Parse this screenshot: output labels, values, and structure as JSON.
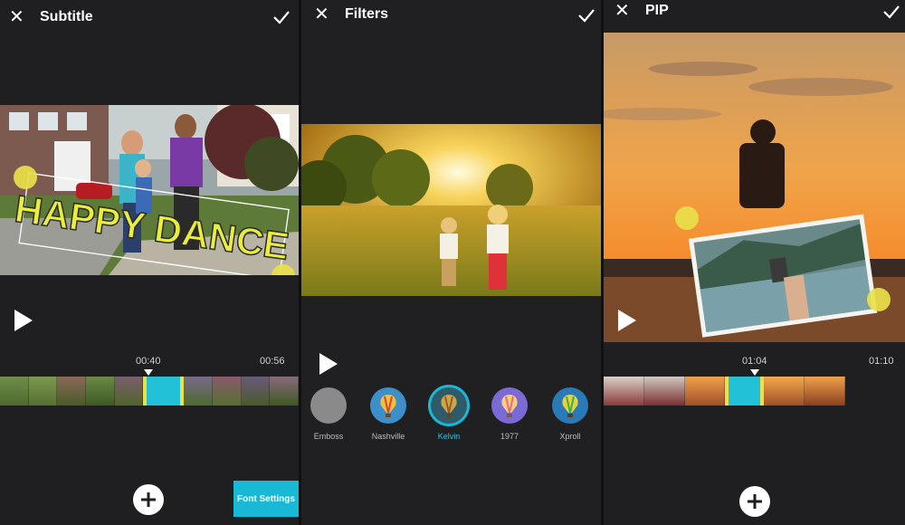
{
  "subtitle_panel": {
    "title": "Subtitle",
    "close_icon": "close-icon",
    "confirm_icon": "checkmark-icon",
    "subtitle_text": "HAPPY DANCE",
    "current_time": "00:40",
    "end_time": "00:56",
    "font_settings_label": "Font Settings",
    "add_icon": "plus-icon"
  },
  "filters_panel": {
    "title": "Filters",
    "close_icon": "close-icon",
    "confirm_icon": "checkmark-icon",
    "filters": [
      {
        "label": "Emboss",
        "selected": false
      },
      {
        "label": "Nashville",
        "selected": false
      },
      {
        "label": "Kelvin",
        "selected": true
      },
      {
        "label": "1977",
        "selected": false
      },
      {
        "label": "Xproll",
        "selected": false
      }
    ]
  },
  "pip_panel": {
    "title": "PIP",
    "close_icon": "close-icon",
    "confirm_icon": "checkmark-icon",
    "current_time": "01:04",
    "end_time": "01:10",
    "add_icon": "plus-icon"
  },
  "colors": {
    "accent": "#19b9d6",
    "selected_filter_label": "#2fc3e0",
    "handle_yellow": "#e9e04a",
    "background": "#1f1f21"
  }
}
